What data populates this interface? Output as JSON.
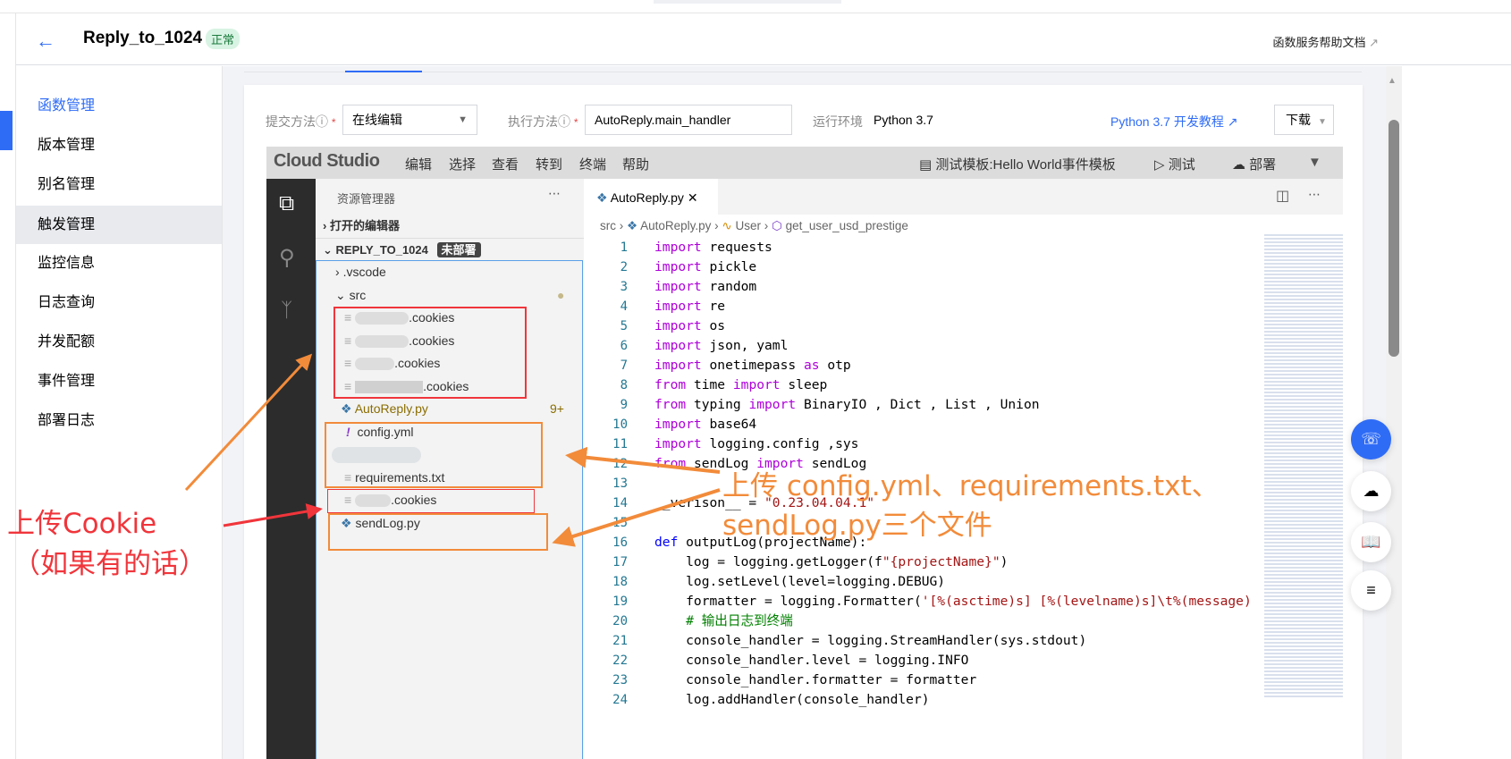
{
  "header": {
    "title": "Reply_to_1024",
    "status": "正常",
    "help_doc": "函数服务帮助文档"
  },
  "sidebar": {
    "items": [
      {
        "label": "函数管理"
      },
      {
        "label": "版本管理"
      },
      {
        "label": "别名管理"
      },
      {
        "label": "触发管理"
      },
      {
        "label": "监控信息"
      },
      {
        "label": "日志查询"
      },
      {
        "label": "并发配额"
      },
      {
        "label": "事件管理"
      },
      {
        "label": "部署日志"
      }
    ],
    "active": "函数管理"
  },
  "form": {
    "submit_label": "提交方法",
    "submit_value": "在线编辑",
    "exec_label": "执行方法",
    "exec_value": "AutoReply.main_handler",
    "runtime_label": "运行环境",
    "runtime_value": "Python 3.7",
    "tutorial_link": "Python 3.7 开发教程",
    "download": "下载"
  },
  "ide": {
    "logo": "Cloud Studio",
    "menu": [
      "编辑",
      "选择",
      "查看",
      "转到",
      "终端",
      "帮助"
    ],
    "test_template": "测试模板:Hello World事件模板",
    "test": "测试",
    "deploy": "部署"
  },
  "explorer": {
    "title": "资源管理器",
    "open_editors": "打开的编辑器",
    "project": "REPLY_TO_1024",
    "project_badge": "未部署",
    "items": [
      ".vscode",
      "src",
      ".cookies",
      ".cookies",
      ".cookies",
      ".cookies",
      "AutoReply.py",
      "config.yml",
      "requirements.txt",
      ".cookies",
      "sendLog.py"
    ],
    "autoreply_badge": "9+"
  },
  "editor": {
    "tab": "AutoReply.py",
    "breadcrumb": [
      "src",
      "AutoReply.py",
      "User",
      "get_user_usd_prestige"
    ],
    "lines": [
      "import requests",
      "import pickle",
      "import random",
      "import re",
      "import os",
      "import json, yaml",
      "import onetimepass as otp",
      "from time import sleep",
      "from typing import BinaryIO , Dict , List , Union",
      "import base64",
      "import logging.config ,sys",
      "from sendLog import sendLog",
      "",
      "__verison__ = \"0.23.04.04.1\"",
      "",
      "def outputLog(projectName):",
      "    log = logging.getLogger(f\"{projectName}\")",
      "    log.setLevel(level=logging.DEBUG)",
      "    formatter = logging.Formatter('[%(asctime)s] [%(levelname)s]\\t%(message)",
      "    # 输出日志到终端",
      "    console_handler = logging.StreamHandler(sys.stdout)",
      "    console_handler.level = logging.INFO",
      "    console_handler.formatter = formatter",
      "    log.addHandler(console_handler)"
    ]
  },
  "annotations": {
    "upload_files": "上传 config.yml、requirements.txt、",
    "upload_files2": "sendLog.py三个文件",
    "upload_cookie": "上传Cookie",
    "upload_cookie2": "（如果有的话）"
  },
  "colors": {
    "accent": "#2f6cf6",
    "annotation_orange": "#f28b3a",
    "annotation_red": "#f0353b"
  }
}
